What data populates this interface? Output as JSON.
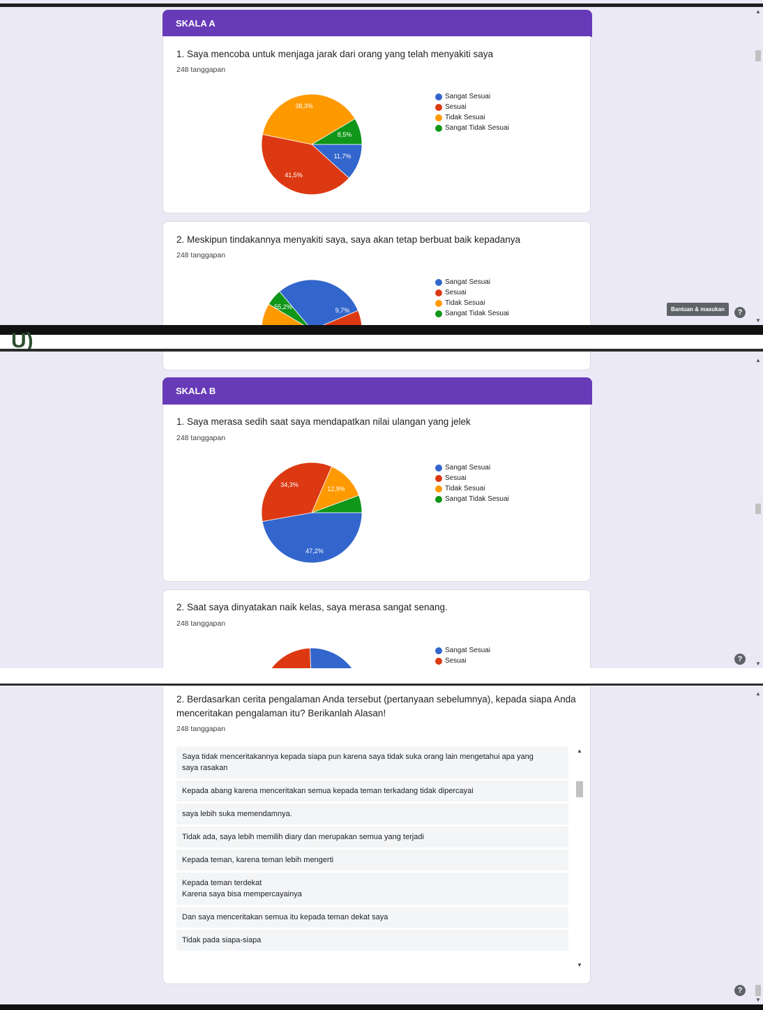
{
  "colors": {
    "purple": "#673ab7",
    "blue": "#3366cc",
    "red": "#dc3912",
    "orange": "#ff9900",
    "green": "#109618"
  },
  "legend": [
    "Sangat Sesuai",
    "Sesuai",
    "Tidak Sesuai",
    "Sangat Tidak Sesuai"
  ],
  "skala_a": {
    "header": "SKALA A",
    "q1": {
      "title": "1. Saya mencoba untuk menjaga jarak dari orang yang telah menyakiti saya",
      "count": "248 tanggapan",
      "labels": [
        "11,7%",
        "41,5%",
        "38,3%",
        "8,5%"
      ]
    },
    "q2": {
      "title": "2. Meskipun tindakannya menyakiti saya, saya akan tetap berbuat baik kepadanya",
      "count": "248 tanggapan",
      "labels": [
        "55,2%",
        "9,7%"
      ]
    },
    "tooltip": "Bantuan & masukan"
  },
  "skala_b": {
    "header": "SKALA B",
    "q1": {
      "title": "1. Saya merasa sedih saat saya mendapatkan nilai ulangan yang jelek",
      "count": "248 tanggapan",
      "labels": [
        "47,2%",
        "34,3%",
        "12,9%"
      ]
    },
    "q2": {
      "title": "2. Saat saya dinyatakan naik kelas, saya merasa sangat senang.",
      "count": "248 tanggapan"
    }
  },
  "separator_text": "U)",
  "open_question": {
    "title_line1": "2. Berdasarkan cerita pengalaman Anda tersebut (pertanyaan sebelumnya), kepada siapa Anda",
    "title_line2": "menceritakan pengalaman itu? Berikanlah Alasan!",
    "count": "248 tanggapan",
    "responses": [
      [
        "Saya tidak menceritakannya kepada siapa pun karena saya tidak suka orang lain mengetahui apa yang",
        "saya rasakan"
      ],
      [
        "Kepada abang karena menceritakan semua kepada teman terkadang tidak dipercayai"
      ],
      [
        "saya lebih suka memendamnya."
      ],
      [
        "Tidak ada, saya lebih memilih diary dan merupakan semua yang terjadi"
      ],
      [
        "Kepada teman, karena teman lebih mengerti"
      ],
      [
        "Kepada teman terdekat",
        "Karena saya bisa mempercayainya"
      ],
      [
        "Dan saya menceritakan semua itu kepada teman dekat saya"
      ],
      [
        "Tidak pada siapa-siapa"
      ]
    ]
  },
  "chart_data": [
    {
      "type": "pie",
      "title": "1. Saya mencoba untuk menjaga jarak dari orang yang telah menyakiti saya",
      "categories": [
        "Sangat Sesuai",
        "Sesuai",
        "Tidak Sesuai",
        "Sangat Tidak Sesuai"
      ],
      "values": [
        11.7,
        41.5,
        38.3,
        8.5
      ]
    },
    {
      "type": "pie",
      "title": "2. Meskipun tindakannya menyakiti saya, saya akan tetap berbuat baik kepadanya",
      "categories": [
        "Sangat Sesuai",
        "Sesuai",
        "Tidak Sesuai",
        "Sangat Tidak Sesuai"
      ],
      "values": [
        29.8,
        55.2,
        9.7,
        5.3
      ]
    },
    {
      "type": "pie",
      "title": "1. Saya merasa sedih saat saya mendapatkan nilai ulangan yang jelek",
      "categories": [
        "Sangat Sesuai",
        "Sesuai",
        "Tidak Sesuai",
        "Sangat Tidak Sesuai"
      ],
      "values": [
        47.2,
        34.3,
        12.9,
        5.6
      ]
    },
    {
      "type": "pie",
      "title": "2. Saat saya dinyatakan naik kelas, saya merasa sangat senang.",
      "categories": [
        "Sangat Sesuai",
        "Sesuai"
      ],
      "values": [
        75,
        25
      ]
    }
  ]
}
